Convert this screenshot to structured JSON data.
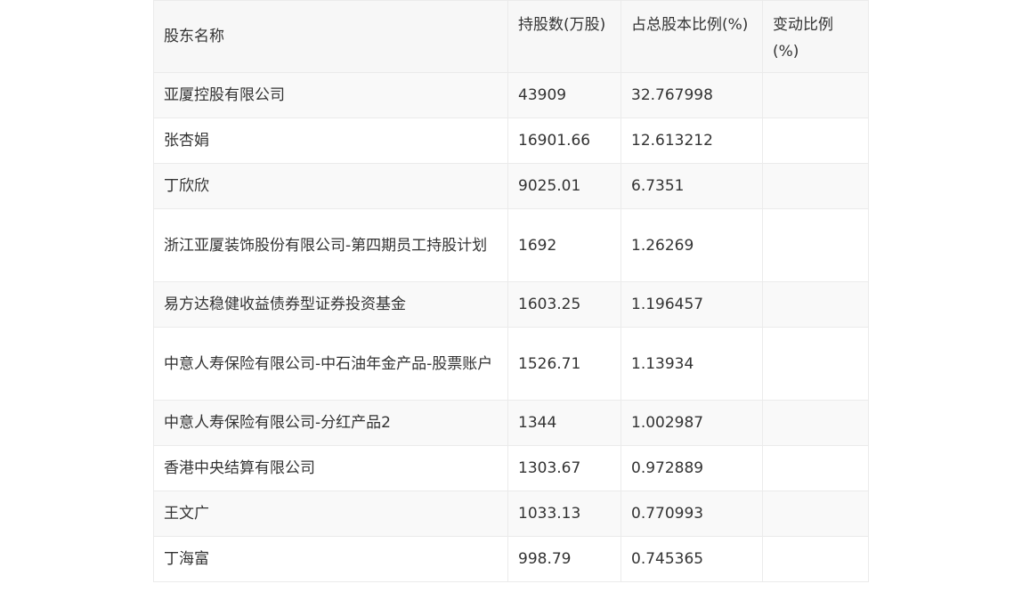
{
  "table": {
    "headers": [
      "股东名称",
      "持股数(万股)",
      "占总股本比例(%)",
      "变动比例(%)"
    ],
    "rows": [
      [
        "亚厦控股有限公司",
        "43909",
        "32.767998",
        ""
      ],
      [
        "张杏娟",
        "16901.66",
        "12.613212",
        ""
      ],
      [
        "丁欣欣",
        "9025.01",
        "6.7351",
        ""
      ],
      [
        "浙江亚厦装饰股份有限公司-第四期员工持股计划",
        "1692",
        "1.26269",
        ""
      ],
      [
        "易方达稳健收益债券型证券投资基金",
        "1603.25",
        "1.196457",
        ""
      ],
      [
        "中意人寿保险有限公司-中石油年金产品-股票账户",
        "1526.71",
        "1.13934",
        ""
      ],
      [
        "中意人寿保险有限公司-分红产品2",
        "1344",
        "1.002987",
        ""
      ],
      [
        "香港中央结算有限公司",
        "1303.67",
        "0.972889",
        ""
      ],
      [
        "王文广",
        "1033.13",
        "0.770993",
        ""
      ],
      [
        "丁海富",
        "998.79",
        "0.745365",
        ""
      ]
    ]
  }
}
